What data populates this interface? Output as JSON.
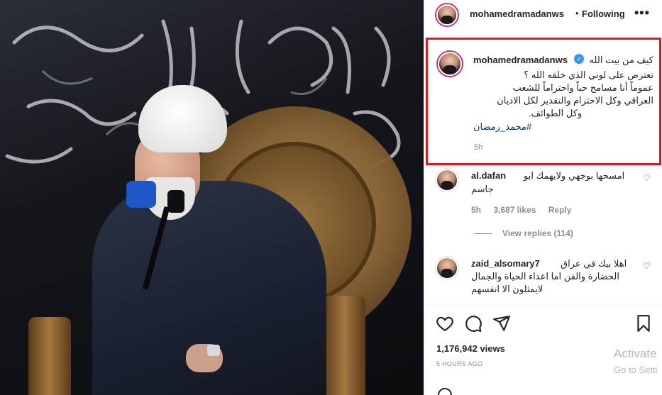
{
  "post": {
    "username": "mohamedramadanws",
    "follow_separator": "•",
    "follow_status": "Following",
    "more_icon": "more-horizontal-icon"
  },
  "caption": {
    "username": "mohamedramadanws",
    "verified": true,
    "lines": [
      "كيف من بيت الله",
      "تعترض على لوني الذي خلقه الله ؟",
      "عموماً أنا مسامح حباً واحتراماً للشعب",
      "العراقي وكل الاحترام والتقدير لكل الاديان",
      "وكل الطوائف."
    ],
    "hashtag": "#محمد_رمضان",
    "time": "5h",
    "highlight_color": "#e0191f"
  },
  "comments": [
    {
      "username": "al.dafan",
      "text_lines": [
        "امسحها بوجهي ولايهمك ابو",
        "جاسم"
      ],
      "time": "5h",
      "likes": "3,687 likes",
      "reply_label": "Reply",
      "view_replies": "View replies (114)"
    },
    {
      "username": "zaid_alsomary7",
      "text_lines": [
        "اهلا بيك في عراق",
        "الحضارة والفن اما اعداء الحياة والجمال",
        "لايمثلون الا انفسهم"
      ]
    }
  ],
  "actions": {
    "like_icon": "heart-icon",
    "comment_icon": "comment-icon",
    "share_icon": "send-icon",
    "save_icon": "bookmark-icon"
  },
  "stats": {
    "views": "1,176,942 views",
    "posted_ago": "5 HOURS AGO"
  },
  "watermark": {
    "line1": "Activate",
    "line2": "Go to Setti"
  },
  "colors": {
    "text": "#262626",
    "muted": "#8e8e8e",
    "verified": "#3897f0",
    "hashtag": "#00376b"
  }
}
